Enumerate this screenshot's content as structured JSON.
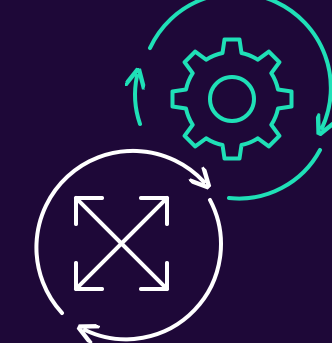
{
  "illustration": {
    "icons": [
      "expand-arrows-icon",
      "gear-icon",
      "circular-arrow-icon"
    ],
    "colors": {
      "background": "#1e0838",
      "accent": "#1fe0b7",
      "foreground": "#ffffff"
    }
  }
}
